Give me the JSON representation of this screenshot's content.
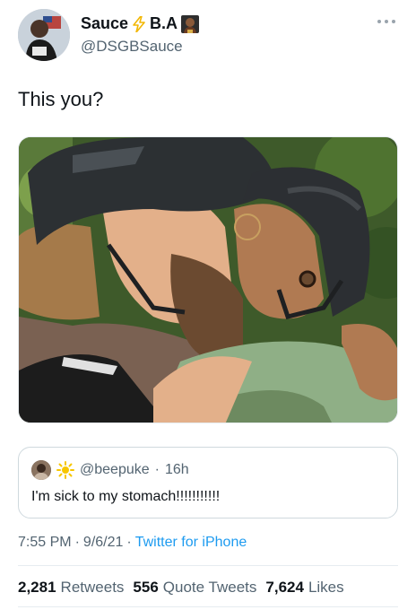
{
  "author": {
    "display_name": "Sauce",
    "display_name_suffix": "B.A",
    "handle": "@DSGBSauce",
    "name_icons": [
      "lightning-bolt-icon",
      "person-emoji-icon"
    ]
  },
  "tweet": {
    "text": "This you?"
  },
  "quote": {
    "handle": "@beepuke",
    "separator": "·",
    "time": "16h",
    "text": "I'm sick to my stomach!!!!!!!!!!!",
    "icons": [
      "sun-icon"
    ]
  },
  "meta": {
    "time": "7:55 PM",
    "sep1": "·",
    "date": "9/6/21",
    "sep2": "·",
    "source": "Twitter for iPhone"
  },
  "stats": {
    "retweets_count": "2,281",
    "retweets_label": "Retweets",
    "quotes_count": "556",
    "quotes_label": "Quote Tweets",
    "likes_count": "7,624",
    "likes_label": "Likes"
  },
  "colors": {
    "link": "#1d9bf0",
    "secondary_text": "#536471",
    "border": "#cfd9de"
  }
}
